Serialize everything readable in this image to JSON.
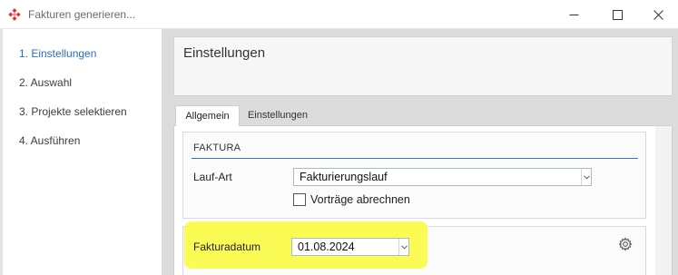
{
  "window": {
    "title": "Fakturen generieren...",
    "app_icon": "diamond-dots-icon",
    "controls": [
      "minimize-icon",
      "maximize-icon",
      "close-icon"
    ]
  },
  "sidebar": {
    "items": [
      {
        "label": "1. Einstellungen",
        "active": true
      },
      {
        "label": "2. Auswahl",
        "active": false
      },
      {
        "label": "3. Projekte selektieren",
        "active": false
      },
      {
        "label": "4. Ausführen",
        "active": false
      }
    ]
  },
  "header": {
    "title": "Einstellungen"
  },
  "tabs": [
    {
      "label": "Allgemein",
      "active": true
    },
    {
      "label": "Einstellungen",
      "active": false
    }
  ],
  "faktura": {
    "section_title": "FAKTURA",
    "lauf_art": {
      "label": "Lauf-Art",
      "value": "Fakturierungslauf"
    },
    "vortraege": {
      "label": "Vorträge abrechnen",
      "checked": false
    }
  },
  "datum": {
    "label": "Fakturadatum",
    "value": "01.08.2024",
    "settings_icon": "gear-icon"
  },
  "colors": {
    "accent": "#2a6ebb",
    "section_rule": "#2f78c4",
    "highlight": "#fbfb55"
  }
}
